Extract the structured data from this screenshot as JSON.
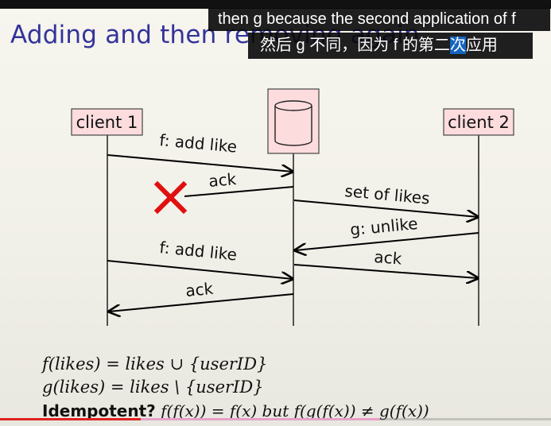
{
  "slide": {
    "title": "Adding and then removing again"
  },
  "captions": {
    "english": "then g because the second application of f",
    "chinese_before": "然后 g 不同，因为 f 的第二",
    "chinese_highlight": "次",
    "chinese_after": "应用"
  },
  "diagram": {
    "nodes": {
      "client1": "client 1",
      "client2": "client 2"
    },
    "messages": {
      "m1": "f: add like",
      "m2": "ack",
      "m3": "set of likes",
      "m4": "g: unlike",
      "m5": "ack",
      "m6": "f: add like",
      "m7": "ack"
    }
  },
  "equations": {
    "f_def": "f(likes) = likes ∪ {userID}",
    "g_def": "g(likes) = likes \\ {userID}",
    "idempotent_label": "Idempotent?",
    "idempotent_rest": "f(f(x)) = f(x) but f(g(f(x)) ≠ g(f(x))"
  },
  "player": {
    "progress_fraction": 0.255
  },
  "colors": {
    "title": "#33339a",
    "node_fill": "#fddcde",
    "lost_marker": "#e01010",
    "caption_highlight": "#1565c0"
  },
  "icons": {
    "lost_message": "x-mark-icon",
    "database": "database-cylinder-icon"
  }
}
